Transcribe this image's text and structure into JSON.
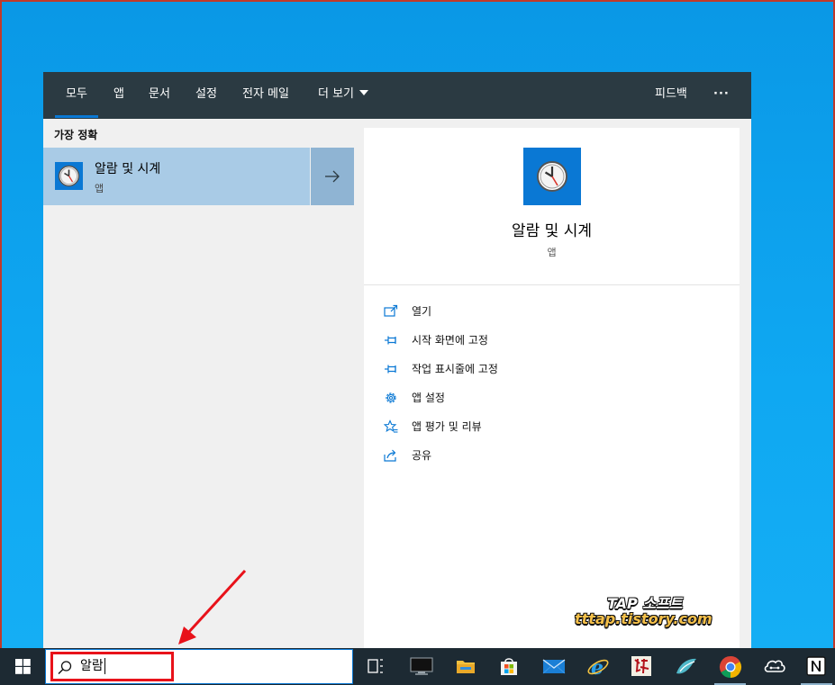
{
  "search_panel": {
    "tabs": [
      {
        "label": "모두",
        "active": true
      },
      {
        "label": "앱"
      },
      {
        "label": "문서"
      },
      {
        "label": "설정"
      },
      {
        "label": "전자 메일"
      },
      {
        "label": "더 보기"
      }
    ],
    "feedback_label": "피드백",
    "more_options_label": "···",
    "best_match": {
      "heading": "가장 정확",
      "name": "알람 및 시계",
      "type": "앱"
    },
    "details": {
      "name": "알람 및 시계",
      "type": "앱",
      "actions": [
        {
          "label": "열기",
          "icon": "open-icon"
        },
        {
          "label": "시작 화면에 고정",
          "icon": "pin-icon"
        },
        {
          "label": "작업 표시줄에 고정",
          "icon": "pin-icon"
        },
        {
          "label": "앱 설정",
          "icon": "gear-icon"
        },
        {
          "label": "앱 평가 및 리뷰",
          "icon": "star-icon"
        },
        {
          "label": "공유",
          "icon": "share-icon"
        }
      ]
    }
  },
  "taskbar": {
    "search_query": "알람",
    "apps": [
      "task-view",
      "monitor",
      "file-explorer",
      "microsoft-store",
      "mail",
      "internet-explorer",
      "calligraphy-app",
      "bird-app",
      "chrome",
      "cloud-app",
      "notion"
    ]
  },
  "watermark": {
    "line1": "TAP 소프트",
    "line2": "tttap.tistory.com"
  },
  "colors": {
    "accent": "#0a78d4",
    "annotation": "#e8121a",
    "topbar": "#2b3a42",
    "taskbar": "#1d2a33"
  }
}
